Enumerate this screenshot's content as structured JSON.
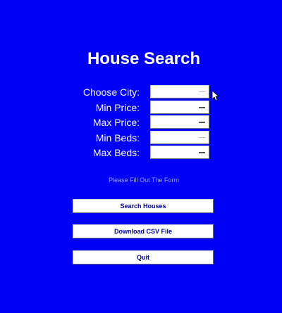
{
  "title": "House Search",
  "form": {
    "fields": [
      {
        "label": "Choose City:",
        "value": ""
      },
      {
        "label": "Min Price:",
        "value": ""
      },
      {
        "label": "Max Price:",
        "value": ""
      },
      {
        "label": "Min Beds:",
        "value": ""
      },
      {
        "label": "Max Beds:",
        "value": ""
      }
    ]
  },
  "status_message": "Please Fill Out The Form",
  "buttons": {
    "search": "Search Houses",
    "download": "Download CSV File",
    "quit": "Quit"
  },
  "colors": {
    "background": "#0000f5",
    "text": "#ffffff",
    "button_text": "#0000a0"
  },
  "icons": {
    "dropdown": "dropdown-arrow-icon",
    "cursor": "cursor-icon"
  }
}
